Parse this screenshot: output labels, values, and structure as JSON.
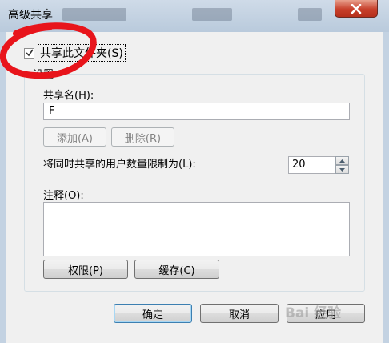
{
  "window": {
    "title": "高级共享",
    "close_icon": "close-icon"
  },
  "share_checkbox": {
    "label": "共享此文件夹(S)",
    "checked": true
  },
  "settings": {
    "legend": "设置",
    "share_name_label": "共享名(H):",
    "share_name_value": "F",
    "add_button": "添加(A)",
    "remove_button": "删除(R)",
    "limit_label": "将同时共享的用户数量限制为(L):",
    "limit_value": "20",
    "comment_label": "注释(O):",
    "comment_value": "",
    "permissions_button": "权限(P)",
    "caching_button": "缓存(C)"
  },
  "footer": {
    "ok_button": "确定",
    "cancel_button": "取消",
    "apply_button": "应用"
  },
  "annotation": {
    "color": "#e8141b"
  },
  "watermark": {
    "text": "Bai 经验"
  }
}
